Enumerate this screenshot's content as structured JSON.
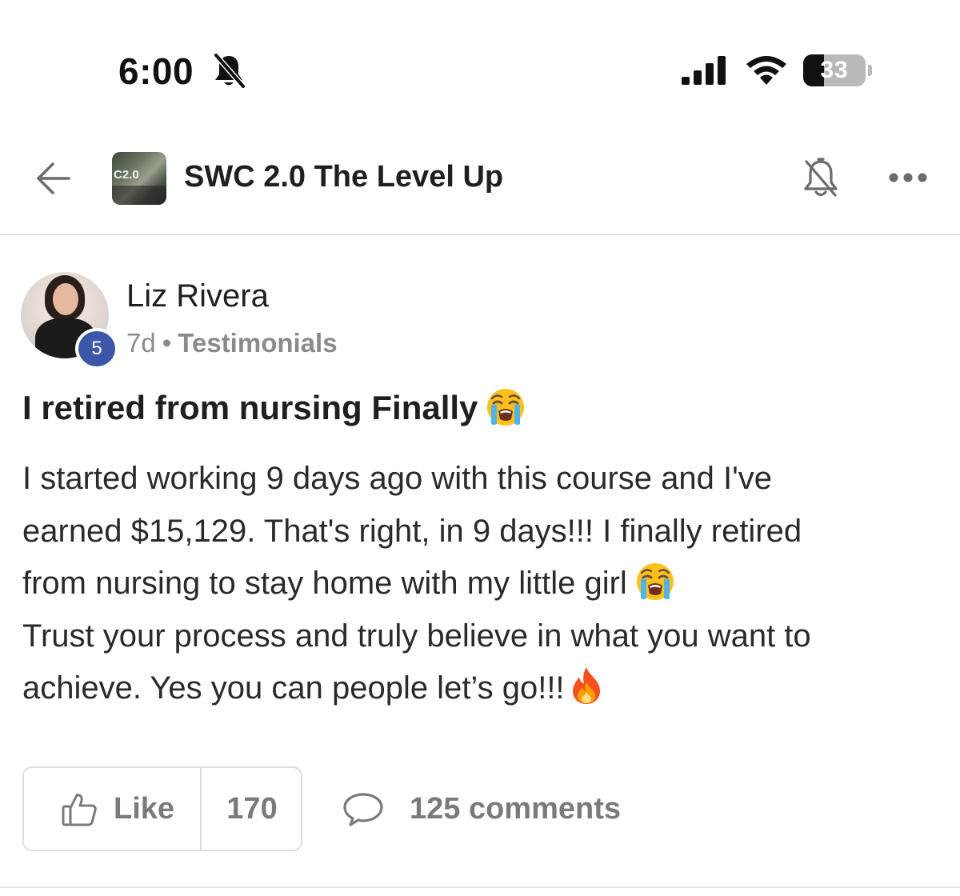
{
  "status_bar": {
    "time": "6:00",
    "battery_percent": "33",
    "battery_level": 0.33,
    "icons": [
      "bell-slash-icon",
      "cellular-signal-icon",
      "wifi-icon",
      "battery-icon"
    ]
  },
  "header": {
    "group_thumbnail_text": "C2.0",
    "group_name": "SWC 2.0 The Level Up",
    "icons": [
      "back-arrow-icon",
      "notification-bell-off-icon",
      "more-options-icon"
    ]
  },
  "post": {
    "author": {
      "name": "Liz Rivera",
      "level": "5"
    },
    "time_ago": "7d",
    "separator": "•",
    "category": "Testimonials",
    "title": "I retired from nursing Finally",
    "body_lines": [
      "I started working 9 days ago with this course and I've",
      "earned $15,129. That's right, in 9 days!!! I finally retired",
      "from nursing to stay home with my little girl",
      "Trust your process and truly believe in what you want to",
      "achieve. Yes you can people let’s go!!!"
    ],
    "emojis": [
      "loudly-crying-face",
      "fire"
    ]
  },
  "actions": {
    "like_label": "Like",
    "like_count": "170",
    "comments_label": "125 comments"
  },
  "colors": {
    "level_badge": "#3c57a8",
    "muted_text": "#8a8a8a",
    "divider": "#e3e3e3"
  }
}
